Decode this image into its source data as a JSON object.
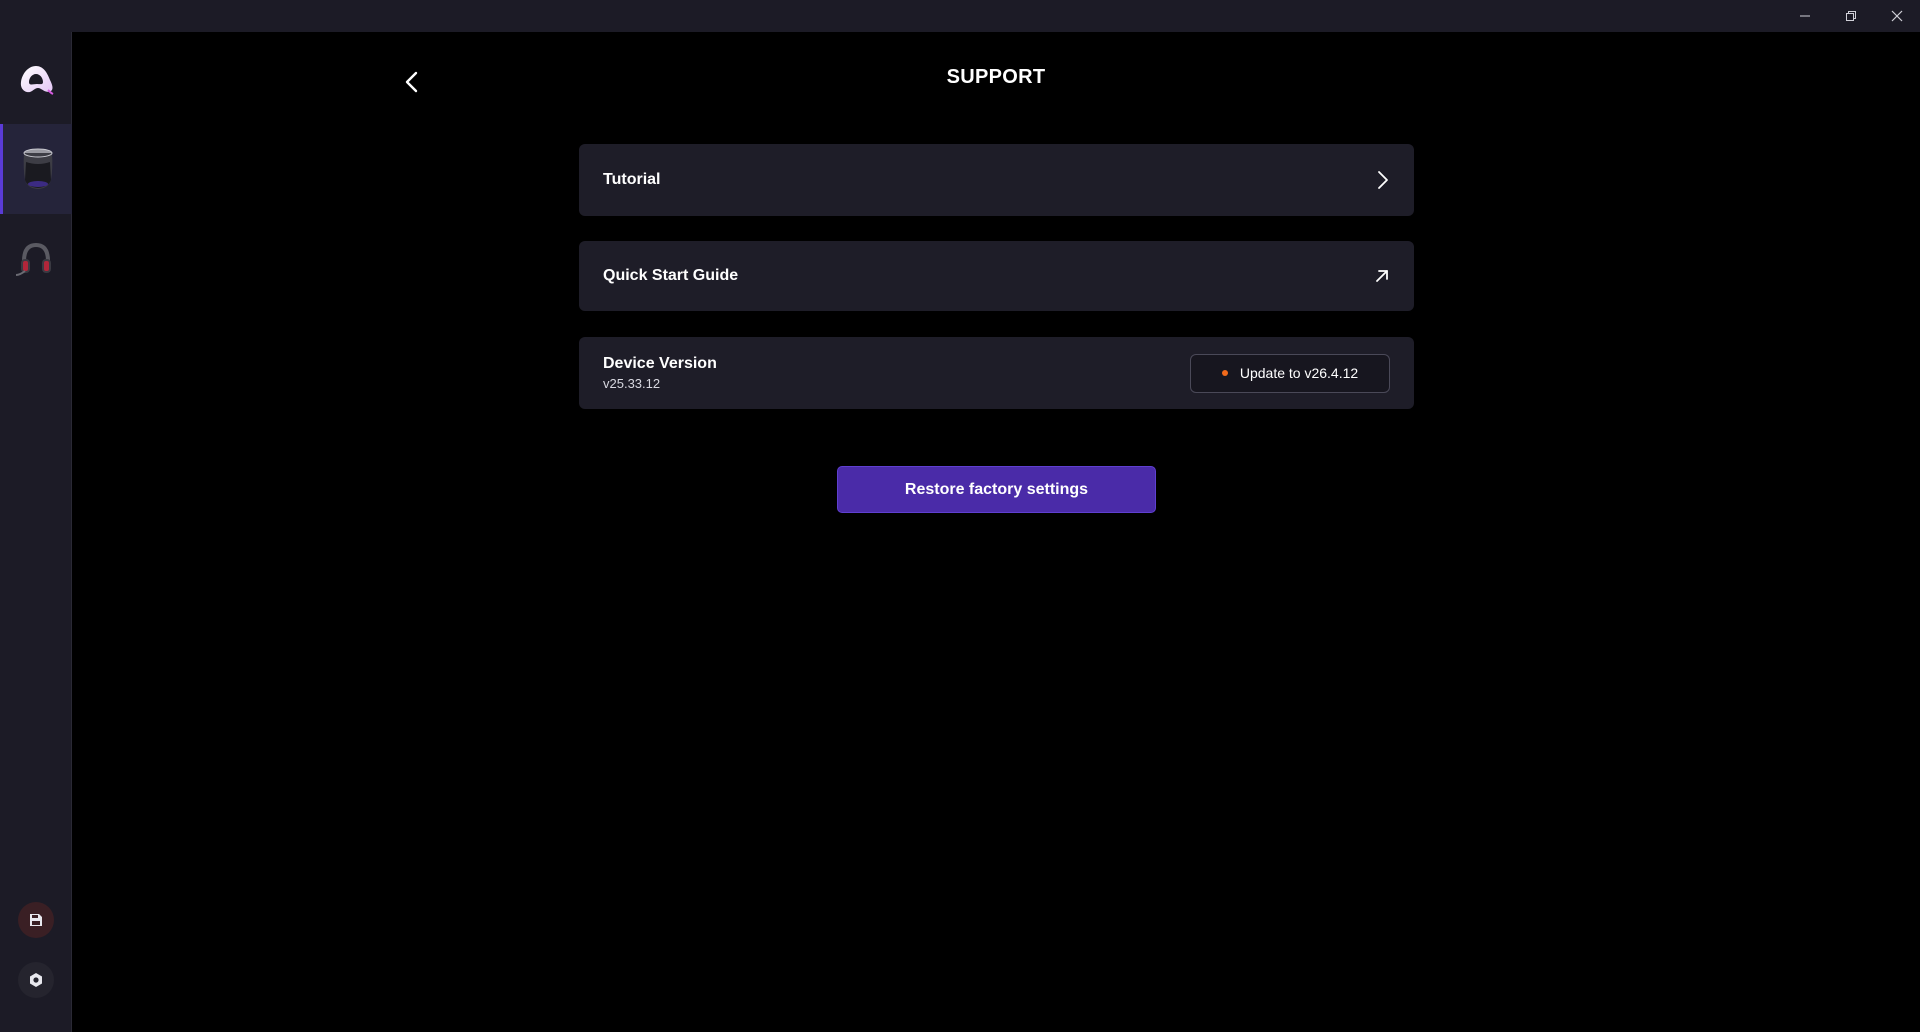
{
  "window": {
    "controls": {
      "minimize_icon": "minimize-icon",
      "restore_icon": "restore-icon",
      "close_icon": "close-icon"
    }
  },
  "sidebar": {
    "logo_icon": "app-logo-icon",
    "devices": [
      {
        "name": "speaker device",
        "icon": "speaker-device-icon",
        "active": true
      },
      {
        "name": "headset device",
        "icon": "headset-device-icon",
        "active": false
      }
    ],
    "bottom_buttons": [
      {
        "icon": "save-icon"
      },
      {
        "icon": "gear-icon"
      }
    ]
  },
  "header": {
    "title": "SUPPORT",
    "back_icon": "chevron-left-icon"
  },
  "menu": {
    "tutorial": {
      "label": "Tutorial",
      "icon": "chevron-right-icon"
    },
    "quick_start": {
      "label": "Quick Start Guide",
      "icon": "external-link-icon"
    },
    "device_version": {
      "label": "Device Version",
      "value": "v25.33.12",
      "update_label": "Update to v26.4.12",
      "update_dot_color": "#f26a1b"
    }
  },
  "actions": {
    "restore_label": "Restore factory settings",
    "restore_color": "#4a2ba8"
  }
}
